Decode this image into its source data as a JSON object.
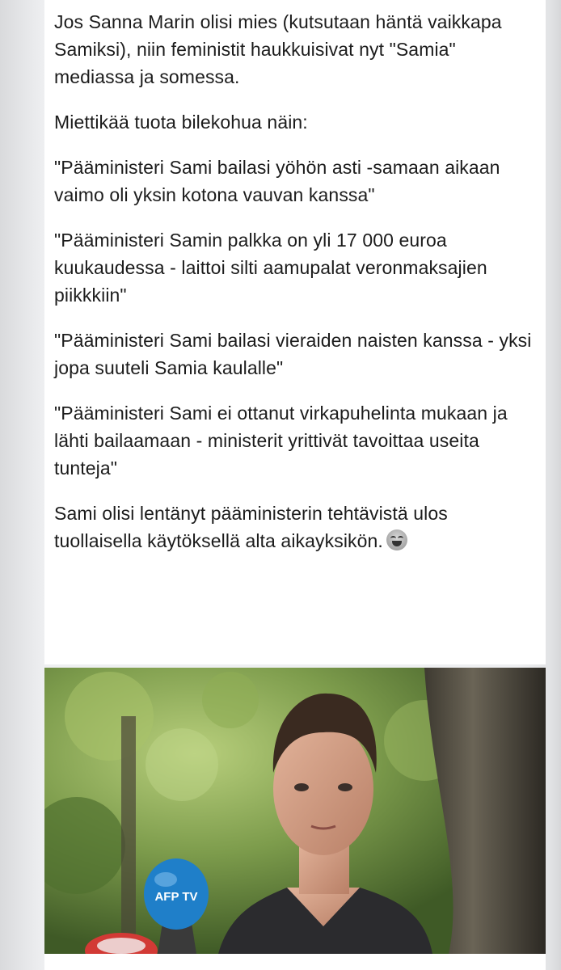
{
  "post": {
    "paragraphs": [
      "Jos Sanna Marin olisi mies (kutsutaan häntä vaikkapa Samiksi), niin feministit haukkuisivat nyt \"Samia\" mediassa ja somessa.",
      "Miettikää tuota bilekohua näin:",
      "\"Pääministeri Sami bailasi yöhön asti -samaan aikaan vaimo oli yksin kotona vauvan kanssa\"",
      "\"Pääministeri Samin palkka on yli 17 000 euroa kuukaudessa - laittoi silti aamupalat veronmaksajien piikkkiin\"",
      "\"Pääministeri Sami bailasi vieraiden naisten kanssa - yksi jopa suuteli Samia kaulalle\"",
      "\"Pääministeri Sami ei ottanut virkapuhelinta mukaan ja lähti bailaamaan - ministerit yrittivät tavoittaa useita tunteja\"",
      "Sami olisi lentänyt pääministerin tehtävistä ulos tuollaisella käytöksellä alta aikayksikön."
    ],
    "emoji": "face-with-tears-of-joy-icon"
  },
  "photo": {
    "microphone_label": "AFP TV"
  },
  "colors": {
    "text": "#1c1c1c",
    "card": "#ffffff",
    "background": "#eeeff1",
    "mic_blue": "#1f7fc9"
  }
}
